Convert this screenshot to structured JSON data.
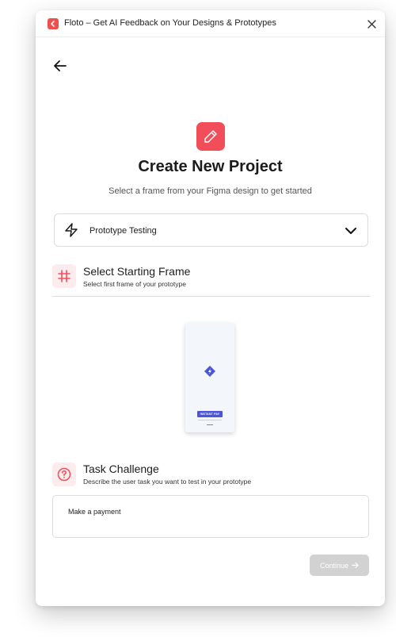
{
  "window": {
    "title": "Floto – Get AI Feedback on Your Designs & Prototypes",
    "logo_icon": "floto-logo-icon",
    "close_icon": "close-icon"
  },
  "nav": {
    "back_icon": "arrow-left-icon"
  },
  "header": {
    "icon": "pencil-icon",
    "title": "Create New Project",
    "subtitle": "Select a frame from your Figma design to get started"
  },
  "project_type": {
    "icon": "lightning-bolt-icon",
    "selected": "Prototype Testing",
    "chevron_icon": "chevron-down-icon"
  },
  "starting_frame": {
    "icon": "frame-hash-icon",
    "title": "Select Starting Frame",
    "description": "Select first frame of your prototype",
    "thumbnail_button_label": "INSTANT PAY"
  },
  "task": {
    "icon": "question-circle-icon",
    "title": "Task Challenge",
    "description": "Describe the user task you want to test in your prototype",
    "value": "Make a payment"
  },
  "actions": {
    "continue_label": "Continue",
    "continue_icon": "arrow-right-icon"
  },
  "colors": {
    "accent": "#f14e5a",
    "accent_light": "#fdecee",
    "button_disabled": "#d2d2d2",
    "thumbnail_button": "#4b55d8"
  }
}
